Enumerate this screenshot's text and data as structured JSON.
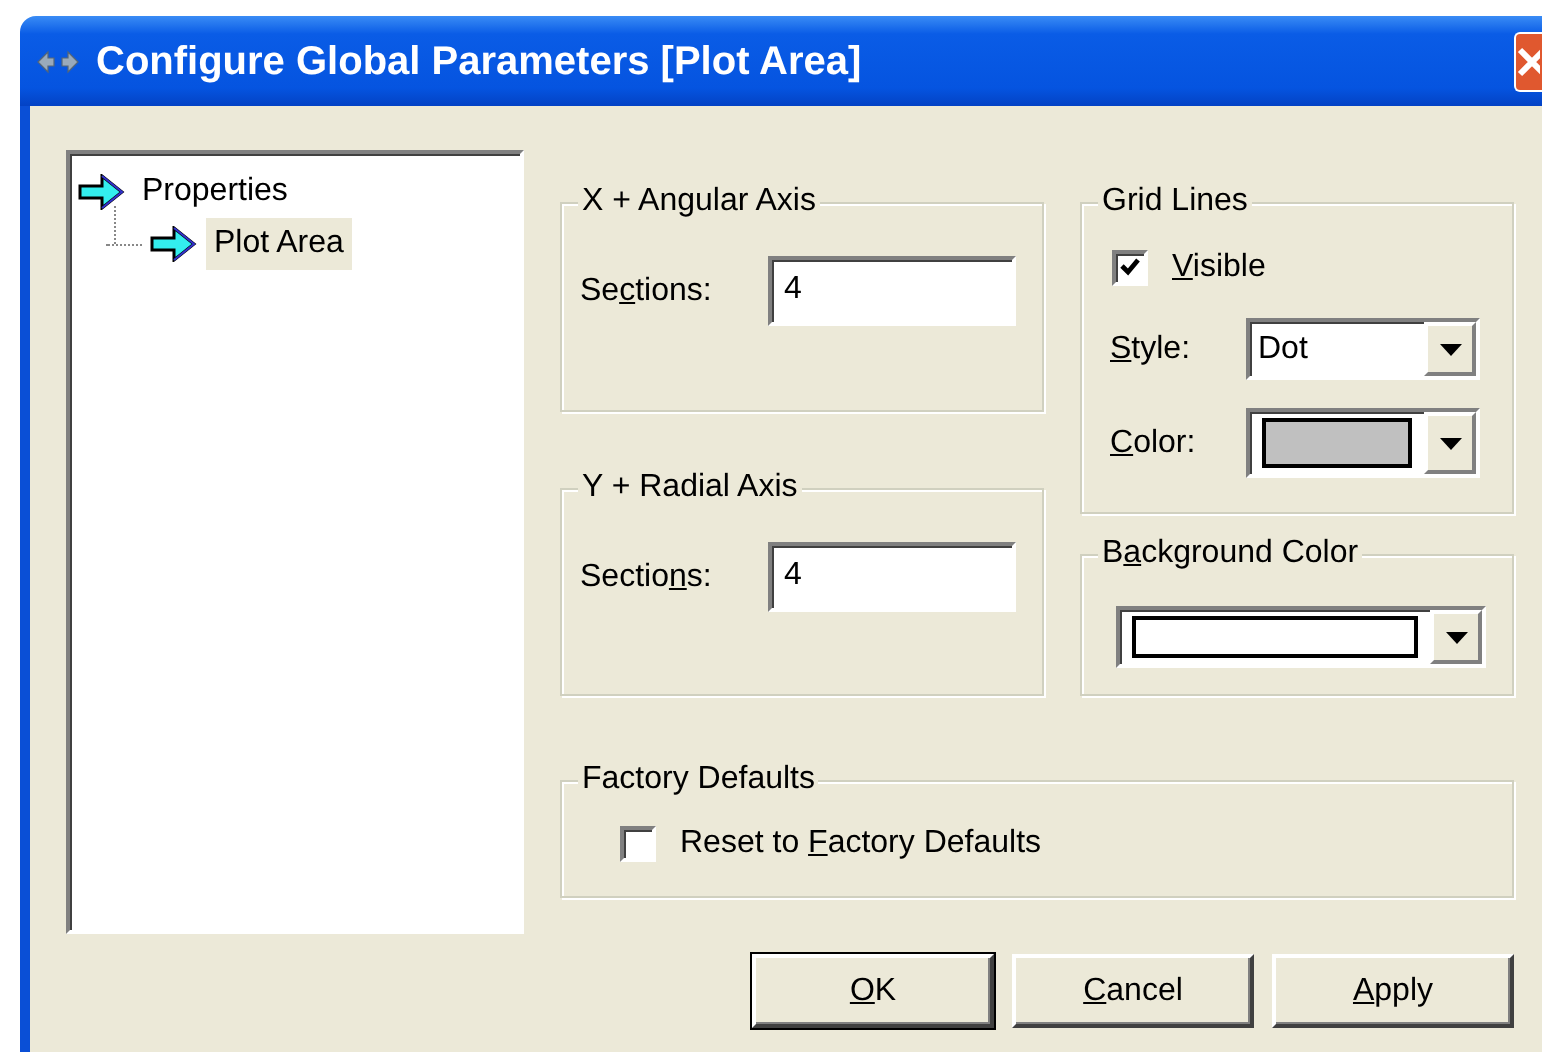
{
  "window": {
    "title": "Configure Global Parameters [Plot Area]"
  },
  "tree": [
    {
      "label": "Properties",
      "selected": false,
      "children": [
        {
          "label": "Plot Area",
          "selected": true
        }
      ]
    }
  ],
  "x_axis": {
    "title": "X + Angular Axis",
    "sections_label": {
      "before": "Se",
      "key": "c",
      "after": "tions:"
    },
    "sections_value": "4"
  },
  "y_axis": {
    "title": "Y + Radial Axis",
    "sections_label": {
      "before": "Sectio",
      "key": "n",
      "after": "s:"
    },
    "sections_value": "4"
  },
  "grid_lines": {
    "title": "Grid Lines",
    "visible": {
      "label": {
        "key": "V",
        "after": "isible"
      },
      "checked": true
    },
    "style": {
      "label": {
        "key": "S",
        "after": "tyle:"
      },
      "value": "Dot"
    },
    "color": {
      "label": {
        "key": "C",
        "after": "olor:"
      },
      "color": "#c0c0c0"
    }
  },
  "background_color": {
    "title": {
      "before": "B",
      "key": "a",
      "after": "ckground Color"
    },
    "color": "#ffffff"
  },
  "factory_defaults": {
    "title": "Factory Defaults",
    "reset": {
      "label": {
        "before": "Reset to ",
        "key": "F",
        "after": "actory Defaults"
      },
      "checked": false
    }
  },
  "buttons": [
    {
      "label": {
        "key": "O",
        "after": "K"
      },
      "default": true
    },
    {
      "label": {
        "key": "C",
        "after": "ancel"
      },
      "default": false
    },
    {
      "label": {
        "key": "A",
        "after": "pply"
      },
      "default": false
    }
  ]
}
